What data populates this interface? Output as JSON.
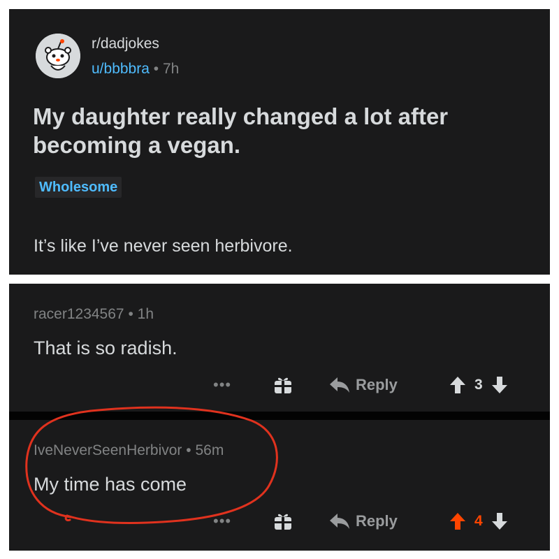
{
  "post": {
    "subreddit": "r/dadjokes",
    "author": "u/bbbbra",
    "age": "7h",
    "title": "My daughter really changed a lot after becoming a vegan.",
    "flair": "Wholesome",
    "body": "It’s like I’ve never seen herbivore."
  },
  "comments": [
    {
      "author": "racer1234567",
      "age": "1h",
      "body": "That is so radish.",
      "more": "•••",
      "reply_label": "Reply",
      "score": "3",
      "upvoted": false
    },
    {
      "author": "IveNeverSeenHerbivor",
      "age": "56m",
      "body": "My time has come",
      "more": "•••",
      "reply_label": "Reply",
      "score": "4",
      "upvoted": true
    }
  ],
  "colors": {
    "background": "#1a1a1b",
    "text": "#d7dadc",
    "muted": "#818384",
    "link": "#4fbcff",
    "upvote": "#ff4500",
    "annotation": "#e0321e"
  },
  "icons": [
    "snoo-avatar-icon",
    "gift-icon",
    "reply-arrow-icon",
    "upvote-icon",
    "downvote-icon"
  ]
}
